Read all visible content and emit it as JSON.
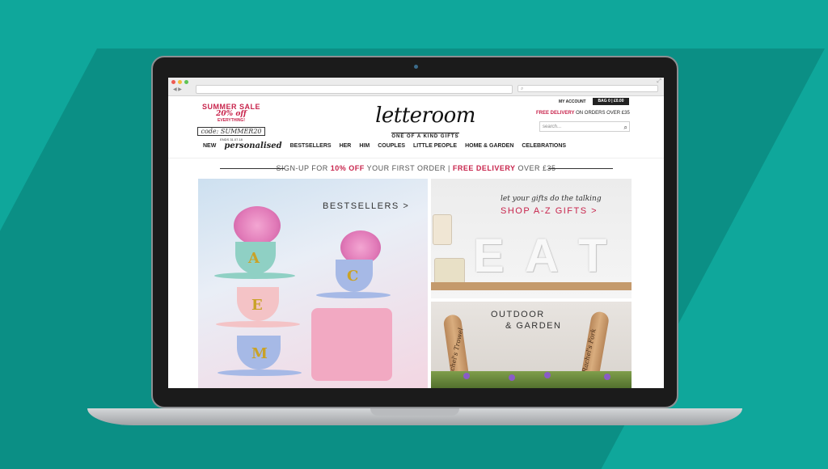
{
  "browser": {
    "search_placeholder": ""
  },
  "header": {
    "sale": {
      "title": "SUMMER SALE",
      "discount": "20% off",
      "everything": "EVERYTHING!",
      "code": "code: SUMMER20",
      "ends": "ENDS 31.07.18"
    },
    "logo": {
      "word": "letteroom",
      "tagline": "ONE OF A KIND GIFTS"
    },
    "account_label": "MY ACCOUNT",
    "bag_label": "BAG 0 | £0.00",
    "delivery": {
      "highlight": "FREE DELIVERY",
      "rest": " ON ORDERS OVER £35"
    },
    "search_placeholder": "search..."
  },
  "menu": [
    "NEW",
    "personalised",
    "BESTSELLERS",
    "HER",
    "HIM",
    "COUPLES",
    "LITTLE PEOPLE",
    "HOME & GARDEN",
    "CELEBRATIONS"
  ],
  "promo": {
    "part1": "SIGN-UP FOR ",
    "part2": "10% OFF",
    "part3": " YOUR FIRST ORDER | ",
    "part4": "FREE DELIVERY",
    "part5": " OVER £35"
  },
  "tiles": {
    "bestsellers": "BESTSELLERS >",
    "eat_script": "let your gifts do the talking",
    "eat_link": "SHOP A-Z GIFTS >",
    "eat_letters": [
      "E",
      "A",
      "T"
    ],
    "cup_letters": [
      "A",
      "C",
      "E",
      "M"
    ],
    "garden_line1": "OUTDOOR",
    "garden_line2": "& GARDEN",
    "trowel1": "Rachel's Trowel",
    "trowel2": "Rachel's Fork"
  },
  "colors": {
    "background": "#0fa79b",
    "accent": "#c8244c"
  }
}
